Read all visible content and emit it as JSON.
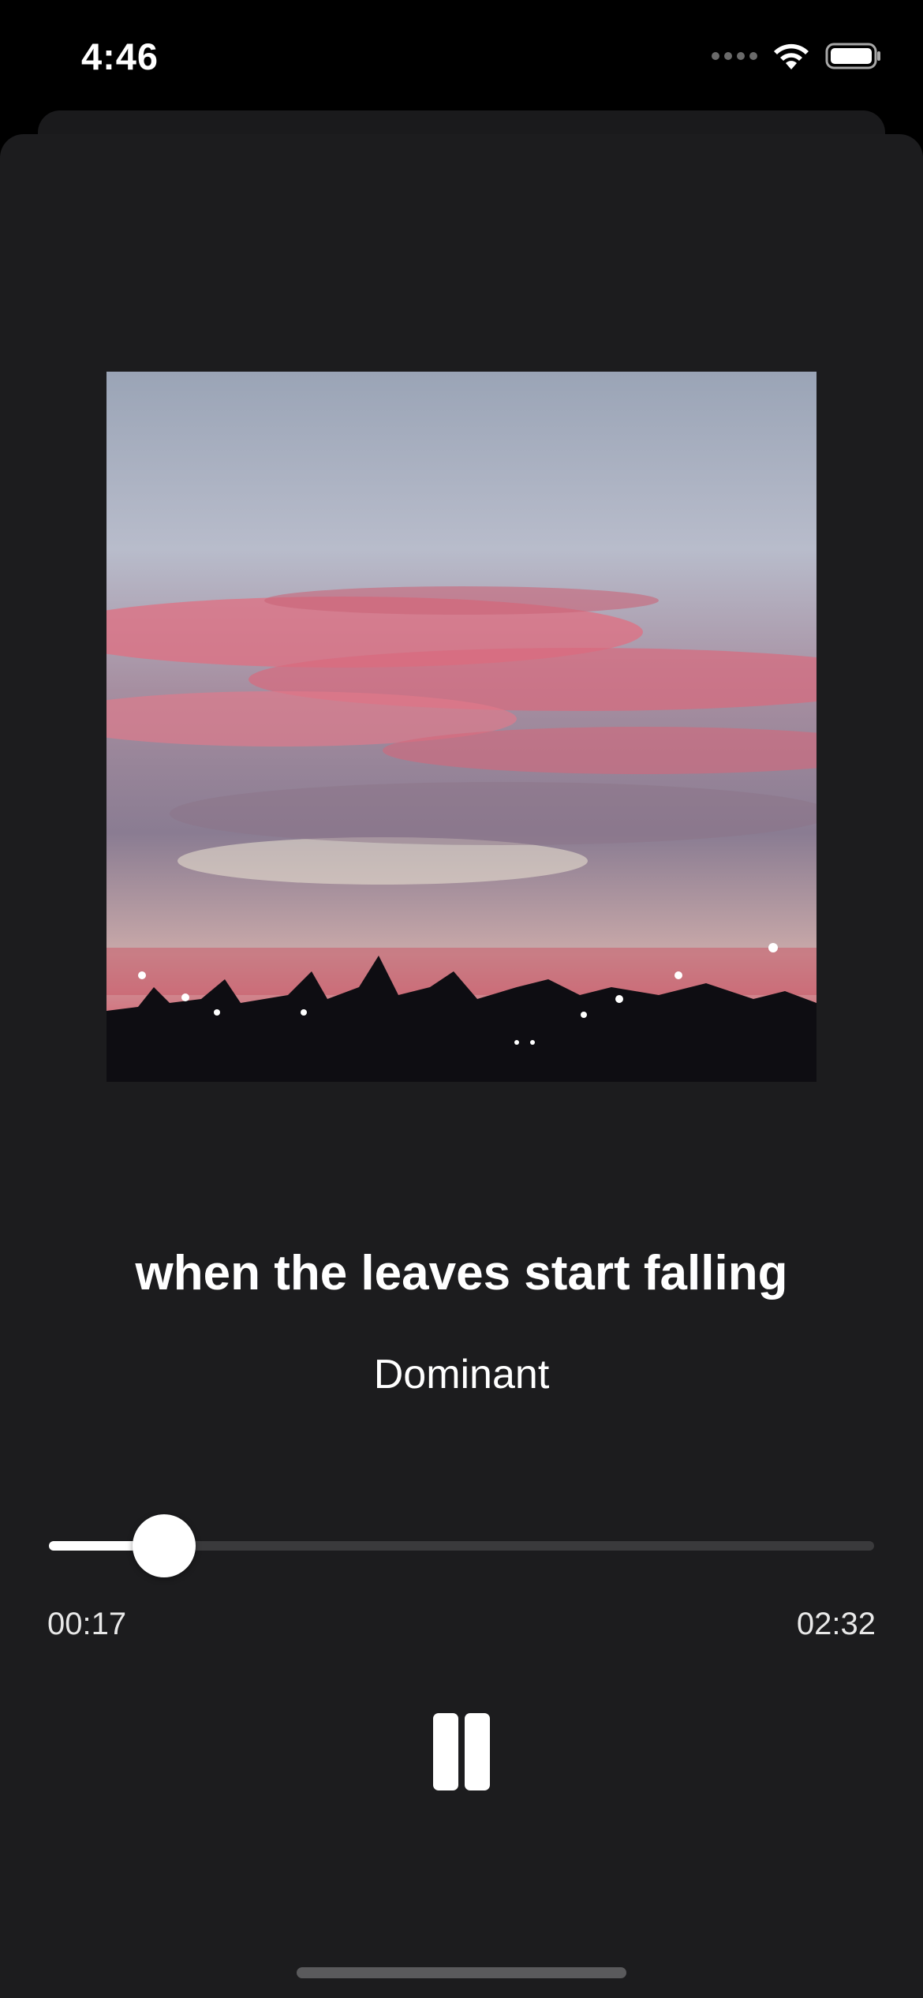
{
  "status_bar": {
    "time": "4:46",
    "icons": [
      "signal-dots-icon",
      "wifi-icon",
      "battery-icon"
    ]
  },
  "now_playing": {
    "artwork_description_icon": "album-artwork",
    "title": "when the leaves start falling",
    "artist": "Dominant",
    "elapsed": "00:17",
    "duration": "02:32",
    "progress_fraction": 0.14,
    "control_icon": "pause-icon"
  },
  "colors": {
    "background": "#000000",
    "sheet": "#1c1c1e",
    "track_inactive": "#3a3a3c",
    "track_active": "#ffffff",
    "text": "#ffffff"
  }
}
